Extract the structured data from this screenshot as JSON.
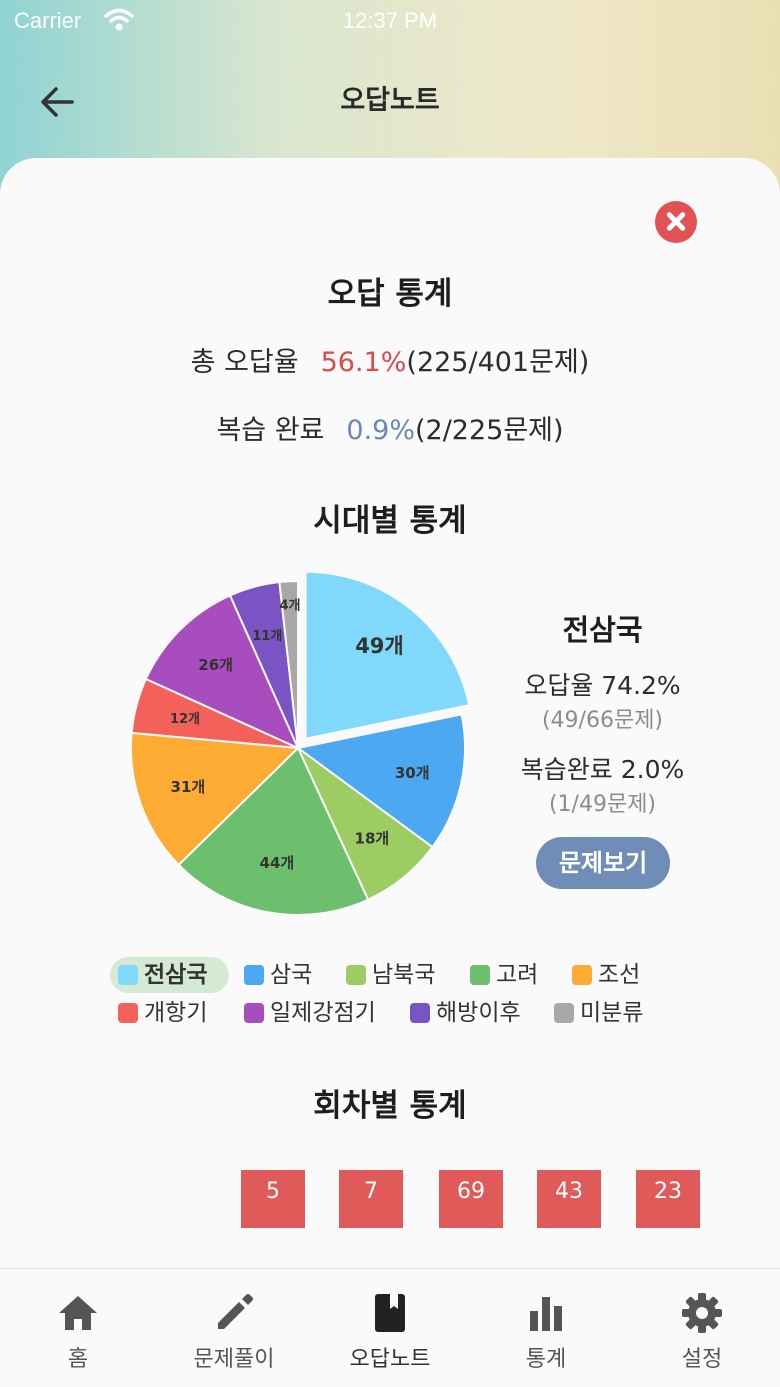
{
  "status_bar": {
    "carrier": "Carrier",
    "time": "12:37 PM"
  },
  "header": {
    "title": "오답노트"
  },
  "wrong_stats": {
    "title": "오답 통계",
    "total_label": "총 오답율",
    "total_rate": "56.1%",
    "total_detail": "(225/401문제)",
    "review_label": "복습 완료",
    "review_rate": "0.9%",
    "review_detail": "(2/225문제)"
  },
  "era_stats": {
    "title": "시대별 통계"
  },
  "chart_data": {
    "type": "pie",
    "unit": "개",
    "categories": [
      "전삼국",
      "삼국",
      "남북국",
      "고려",
      "조선",
      "개항기",
      "일제강점기",
      "해방이후",
      "미분류"
    ],
    "values": [
      49,
      30,
      18,
      44,
      31,
      12,
      26,
      11,
      4
    ],
    "colors": [
      "#80d8fb",
      "#4ba8f1",
      "#9ccc62",
      "#6cbf6c",
      "#fdab33",
      "#f3615a",
      "#a74dbd",
      "#7a54c2",
      "#a8a8a8"
    ],
    "labels": [
      "49개",
      "30개",
      "18개",
      "44개",
      "31개",
      "12개",
      "26개",
      "11개",
      "4개"
    ],
    "selected": "전삼국",
    "legend_position": "bottom"
  },
  "detail": {
    "title": "전삼국",
    "rate_label": "오답율 74.2%",
    "rate_sub": "(49/66문제)",
    "review_label": "복습완료 2.0%",
    "review_sub": "(1/49문제)",
    "view_button": "문제보기"
  },
  "round_stats": {
    "title": "회차별 통계",
    "values": [
      "5",
      "7",
      "69",
      "43",
      "23"
    ]
  },
  "tabs": [
    {
      "label": "홈",
      "icon": "home-icon"
    },
    {
      "label": "문제풀이",
      "icon": "pencil-icon"
    },
    {
      "label": "오답노트",
      "icon": "book-icon",
      "active": true
    },
    {
      "label": "통계",
      "icon": "bar-chart-icon"
    },
    {
      "label": "설정",
      "icon": "gear-icon"
    }
  ]
}
